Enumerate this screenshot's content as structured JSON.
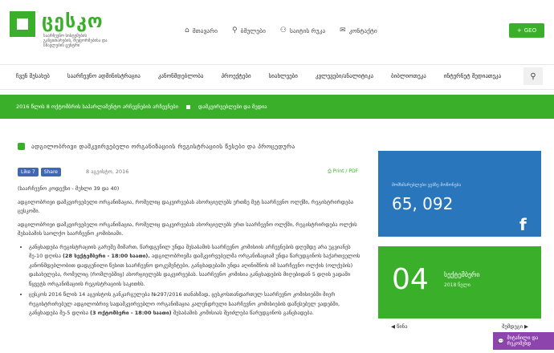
{
  "logo": {
    "name": "ცესკო",
    "subtitle": "საარჩევნო სისტემების განვითარების, რეფორმებისა და სწავლების ცენტრი"
  },
  "topnav": [
    {
      "icon": "home-icon",
      "glyph": "⌂",
      "label": "მთავარი"
    },
    {
      "icon": "link-icon",
      "glyph": "🔗",
      "label": "ბმულები"
    },
    {
      "icon": "sitemap-icon",
      "glyph": "⚇",
      "label": "საიტის რუკა"
    },
    {
      "icon": "mail-icon",
      "glyph": "✉",
      "label": "კონტაქტი"
    }
  ],
  "geo_button": "GEO",
  "mainmenu": [
    "ჩვენ შესახებ",
    "საარჩევნო ადმინისტრაცია",
    "კანონმდებლობა",
    "პროექტები",
    "სიახლეები",
    "კვლევები/ანალიტიკა",
    "ბიბლიოთეკა",
    "ინტერნეტ მედიათეკა"
  ],
  "ticker": {
    "item1": "2016 წლის 8 ოქტომბრის საპარლამენტო არჩევნების არჩევნები",
    "item2": "დამკვირვებლები და მედია"
  },
  "article": {
    "title": "ადგილობრივი დამკვირვებელი ორგანიზაციის რეგისტრაციის წესები და პროცედურა",
    "like_label": "Like 7",
    "share_label": "Share",
    "date": "8 აგვისტო, 2016",
    "print_label": "Print / PDF",
    "intro": "(საარჩევნო კოდექსი - მუხლი 39 და 40)",
    "para1": "ადგილობრივი დამკვირვებელი ორგანიზაცია, რომელიც დაკვირვებას ახორციელებს ერთზე მეტ საარჩევნო ოლქში, რეგისტრირდება ცესკოში.",
    "para2": "ადგილობრივი დამკვირვებელი ორგანიზაცია, რომელიც დაკვირვებას ახორციელებს ერთ საარჩევნო ოლქში, რეგისტრირდება ოლქის შესაბამის საოლქო საარჩევნო კომისიაში.",
    "bullet1_a": "განცხადება რეგისტრაციის გარეშე მიმართ, წარდგენილ უნდა შესაბამის საარჩევნო კომისიის არჩევნების დღემდე არა უგვიანეს მე-10 დღისა",
    "bullet1_bold": "(28 სექტემბერი - 18:00 საათი).",
    "bullet1_b": "ადგილობრივმა დამკვირვებელმა ორგანიზაციამ უნდა წარუდგინოს საქართველოს კანონმდებლობით დადგენილი წესით საარჩევნო დოკუმენტები, განცხადებაში უნდა აღინიშნოს იმ საარჩევნო ოლქის (ოლქების) დასახელება, რომელიც (რომლებშიც) ახორციელებს დაკვირვებას. საარჩევნო კომისია განცხადების მიღებიდან 5 დღის ვადაში წყვეტს ორგანიზაციის რეგისტრაციის საკითხს.",
    "bullet2_a": "ცესკოს 2016 წლის 14 აგვისტოს განკარგულება №297/2016 თანახმად, ცესკოსთანდართულ საარჩევნო კომისიებში მიერ რეგისტრირებულ ადგილობრივ სადამკვირვებლო ორგანიზაცია კალენდრული საარჩევნო კომისიების დაწესებულ ვადებში, განცხადება მე-5 დღისა",
    "bullet2_bold": "(3 ოქტომბერი - 18:00 საათი)",
    "bullet2_b": "შესაბამის კომისიას შეიძლება წარუდგინოს განცხადება."
  },
  "sidebar": {
    "fans_label": "მომხმარებლები ვებზე მოწონება",
    "fans_count": "65, 092",
    "fb_glyph": "f",
    "calendar_day": "04",
    "calendar_month": "სექტემბერი",
    "calendar_year": "2018 წელი",
    "prev_label": "◀ წინა",
    "next_label": "შემდეგი ▶"
  },
  "chat_label": "მიტანილი და რეკომენდ",
  "colors": {
    "brand_green": "#3ab02a",
    "facebook_blue": "#2a76bd",
    "chat_purple": "#8e44ad"
  }
}
